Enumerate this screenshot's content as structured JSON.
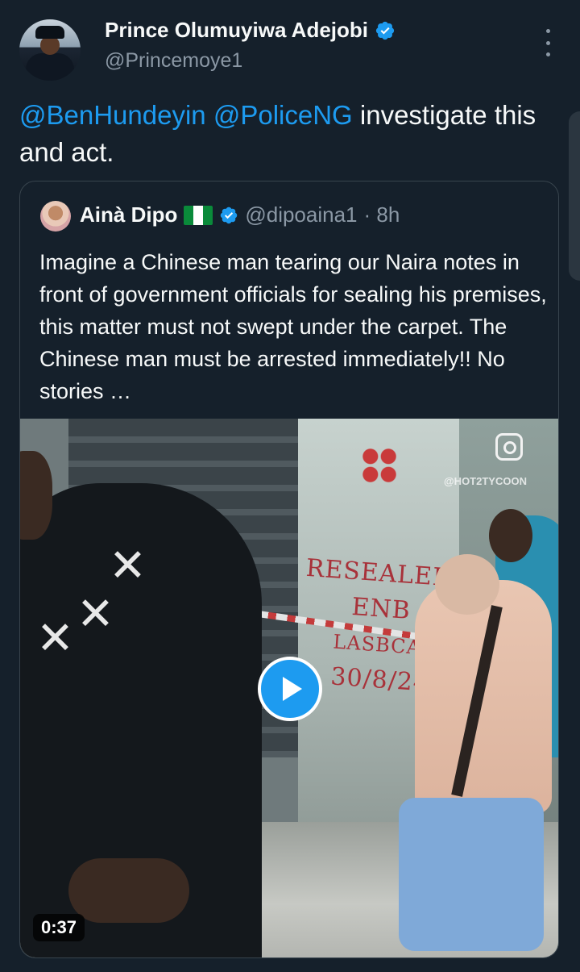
{
  "author": {
    "display_name": "Prince Olumuyiwa Adejobi",
    "handle": "@Princemoye1",
    "verified": true
  },
  "tweet": {
    "mentions": [
      "@BenHundeyin",
      "@PoliceNG"
    ],
    "text_after": "investigate this and act."
  },
  "quoted": {
    "display_name": "Ainà Dipo",
    "flag": "Nigeria",
    "verified": true,
    "handle": "@dipoaina1",
    "time": "· 8h",
    "text": "Imagine a Chinese man tearing our Naira notes in front of government officials for sealing his premises, this matter must not swept under the carpet. The Chinese man must be arrested immediately!! No stories …",
    "video": {
      "duration": "0:37",
      "watermark": "@HOT2TYCOON",
      "graffiti": [
        "RESEALED",
        "ENB",
        "LASBCA",
        "30/8/24"
      ]
    }
  },
  "colors": {
    "background": "#15202b",
    "accent": "#1d9bf0",
    "secondary_text": "#8b98a5",
    "border": "#38444d"
  },
  "icons": [
    "verified-badge-icon",
    "more-options-icon",
    "play-icon",
    "instagram-icon"
  ]
}
